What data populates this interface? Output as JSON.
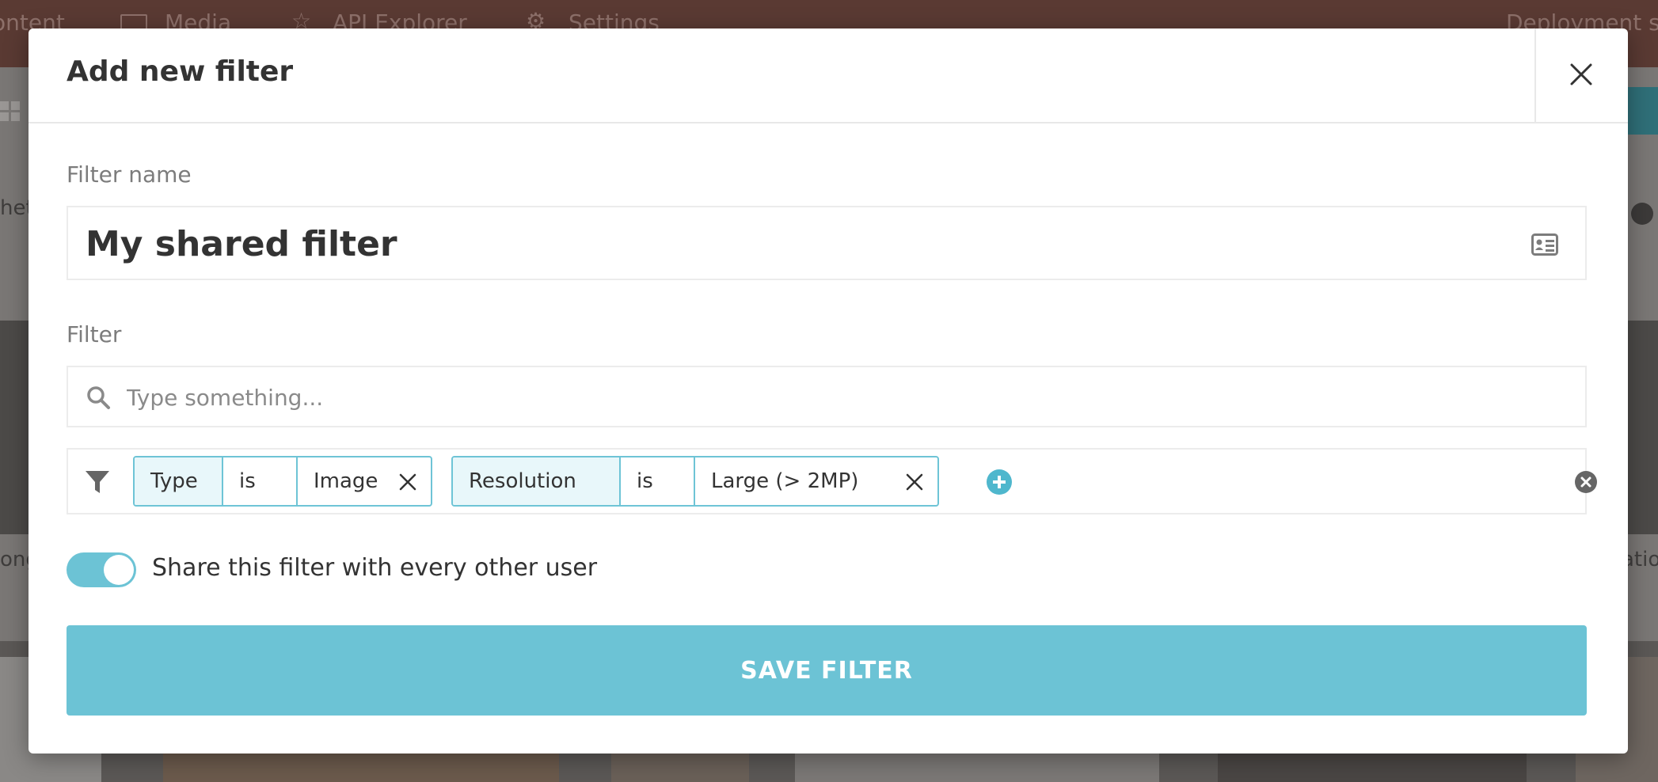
{
  "background": {
    "nav": {
      "items": [
        {
          "label": "ontent"
        },
        {
          "label": "Media"
        },
        {
          "label": "API Explorer"
        },
        {
          "label": "Settings"
        }
      ],
      "right_label": "Deployment s"
    },
    "left_text_1": "het",
    "left_text_2": "ong",
    "right_text": "atio"
  },
  "modal": {
    "title": "Add new filter",
    "close_icon": "close-icon",
    "filter_name": {
      "label": "Filter name",
      "value": "My shared filter",
      "icon": "id-card-icon"
    },
    "filter": {
      "label": "Filter",
      "search_placeholder": "Type something...",
      "search_icon": "search-icon",
      "funnel_icon": "funnel-icon",
      "chips": [
        {
          "key": "Type",
          "operator": "is",
          "value": "Image"
        },
        {
          "key": "Resolution",
          "operator": "is",
          "value": "Large (> 2MP)"
        }
      ],
      "add_icon": "plus-circle-icon",
      "clear_icon": "x-circle-icon"
    },
    "share": {
      "enabled": true,
      "label": "Share this filter with every other user"
    },
    "save_label": "SAVE FILTER",
    "accent_color": "#6cc3d5"
  }
}
